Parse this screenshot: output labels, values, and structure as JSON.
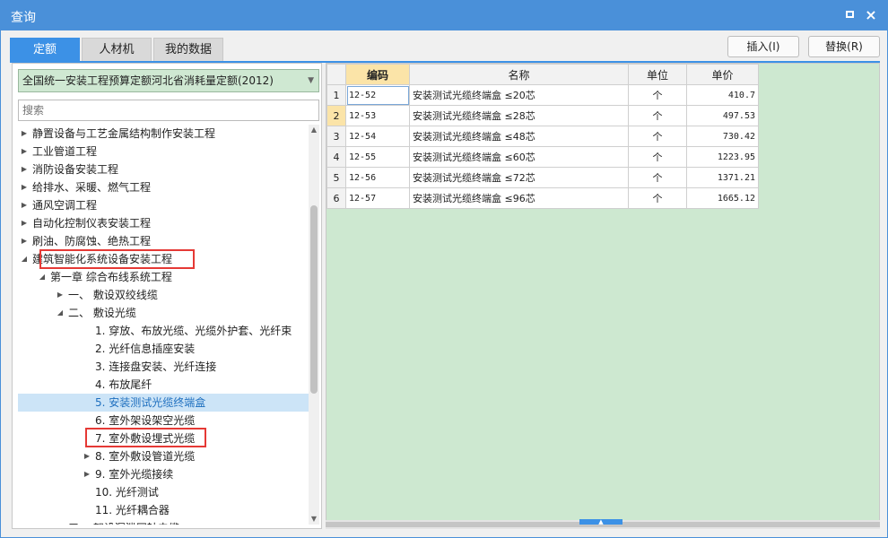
{
  "window": {
    "title": "查询"
  },
  "tabs": [
    {
      "label": "定额",
      "active": true
    },
    {
      "label": "人材机",
      "active": false
    },
    {
      "label": "我的数据",
      "active": false
    }
  ],
  "toolbar": {
    "insert_label": "插入(I)",
    "replace_label": "替换(R)"
  },
  "left": {
    "library_select": "全国统一安装工程预算定额河北省消耗量定额(2012)",
    "search_placeholder": "搜索",
    "tree": [
      {
        "label": "静置设备与工艺金属结构制作安装工程",
        "level": 0,
        "arrow": "right"
      },
      {
        "label": "工业管道工程",
        "level": 0,
        "arrow": "right"
      },
      {
        "label": "消防设备安装工程",
        "level": 0,
        "arrow": "right"
      },
      {
        "label": "给排水、采暖、燃气工程",
        "level": 0,
        "arrow": "right"
      },
      {
        "label": "通风空调工程",
        "level": 0,
        "arrow": "right"
      },
      {
        "label": "自动化控制仪表安装工程",
        "level": 0,
        "arrow": "right"
      },
      {
        "label": "刷油、防腐蚀、绝热工程",
        "level": 0,
        "arrow": "right"
      },
      {
        "label": "建筑智能化系统设备安装工程",
        "level": 0,
        "arrow": "down"
      },
      {
        "label": "第一章 综合布线系统工程",
        "level": 1,
        "arrow": "down"
      },
      {
        "label": "一、 敷设双绞线缆",
        "level": 2,
        "arrow": "right"
      },
      {
        "label": "二、 敷设光缆",
        "level": 2,
        "arrow": "down"
      },
      {
        "label": "1. 穿放、布放光缆、光缆外护套、光纤束",
        "level": 3,
        "arrow": ""
      },
      {
        "label": "2. 光纤信息插座安装",
        "level": 3,
        "arrow": ""
      },
      {
        "label": "3. 连接盘安装、光纤连接",
        "level": 3,
        "arrow": ""
      },
      {
        "label": "4. 布放尾纤",
        "level": 3,
        "arrow": ""
      },
      {
        "label": "5. 安装测试光缆终端盒",
        "level": 3,
        "arrow": "",
        "selected": true
      },
      {
        "label": "6. 室外架设架空光缆",
        "level": 3,
        "arrow": ""
      },
      {
        "label": "7. 室外敷设埋式光缆",
        "level": 3,
        "arrow": ""
      },
      {
        "label": "8. 室外敷设管道光缆",
        "level": 3,
        "arrow": "right"
      },
      {
        "label": "9. 室外光缆接续",
        "level": 3,
        "arrow": "right"
      },
      {
        "label": "10. 光纤测试",
        "level": 3,
        "arrow": ""
      },
      {
        "label": "11. 光纤耦合器",
        "level": 3,
        "arrow": ""
      },
      {
        "label": "三、 架设漏泄同轴电缆",
        "level": 2,
        "arrow": "right"
      }
    ]
  },
  "grid": {
    "columns": [
      "编码",
      "名称",
      "单位",
      "单价"
    ],
    "rows": [
      {
        "num": "1",
        "code": "12-52",
        "name": "安装测试光缆终端盒 ≤20芯",
        "unit": "个",
        "price": "410.7"
      },
      {
        "num": "2",
        "code": "12-53",
        "name": "安装测试光缆终端盒 ≤28芯",
        "unit": "个",
        "price": "497.53"
      },
      {
        "num": "3",
        "code": "12-54",
        "name": "安装测试光缆终端盒 ≤48芯",
        "unit": "个",
        "price": "730.42"
      },
      {
        "num": "4",
        "code": "12-55",
        "name": "安装测试光缆终端盒 ≤60芯",
        "unit": "个",
        "price": "1223.95"
      },
      {
        "num": "5",
        "code": "12-56",
        "name": "安装测试光缆终端盒 ≤72芯",
        "unit": "个",
        "price": "1371.21"
      },
      {
        "num": "6",
        "code": "12-57",
        "name": "安装测试光缆终端盒 ≤96芯",
        "unit": "个",
        "price": "1665.12"
      }
    ]
  },
  "colors": {
    "titlebar": "#4a90d9",
    "accent": "#3c91e6",
    "highlight_box": "#e53935",
    "grid_bg": "#cde8d0"
  }
}
